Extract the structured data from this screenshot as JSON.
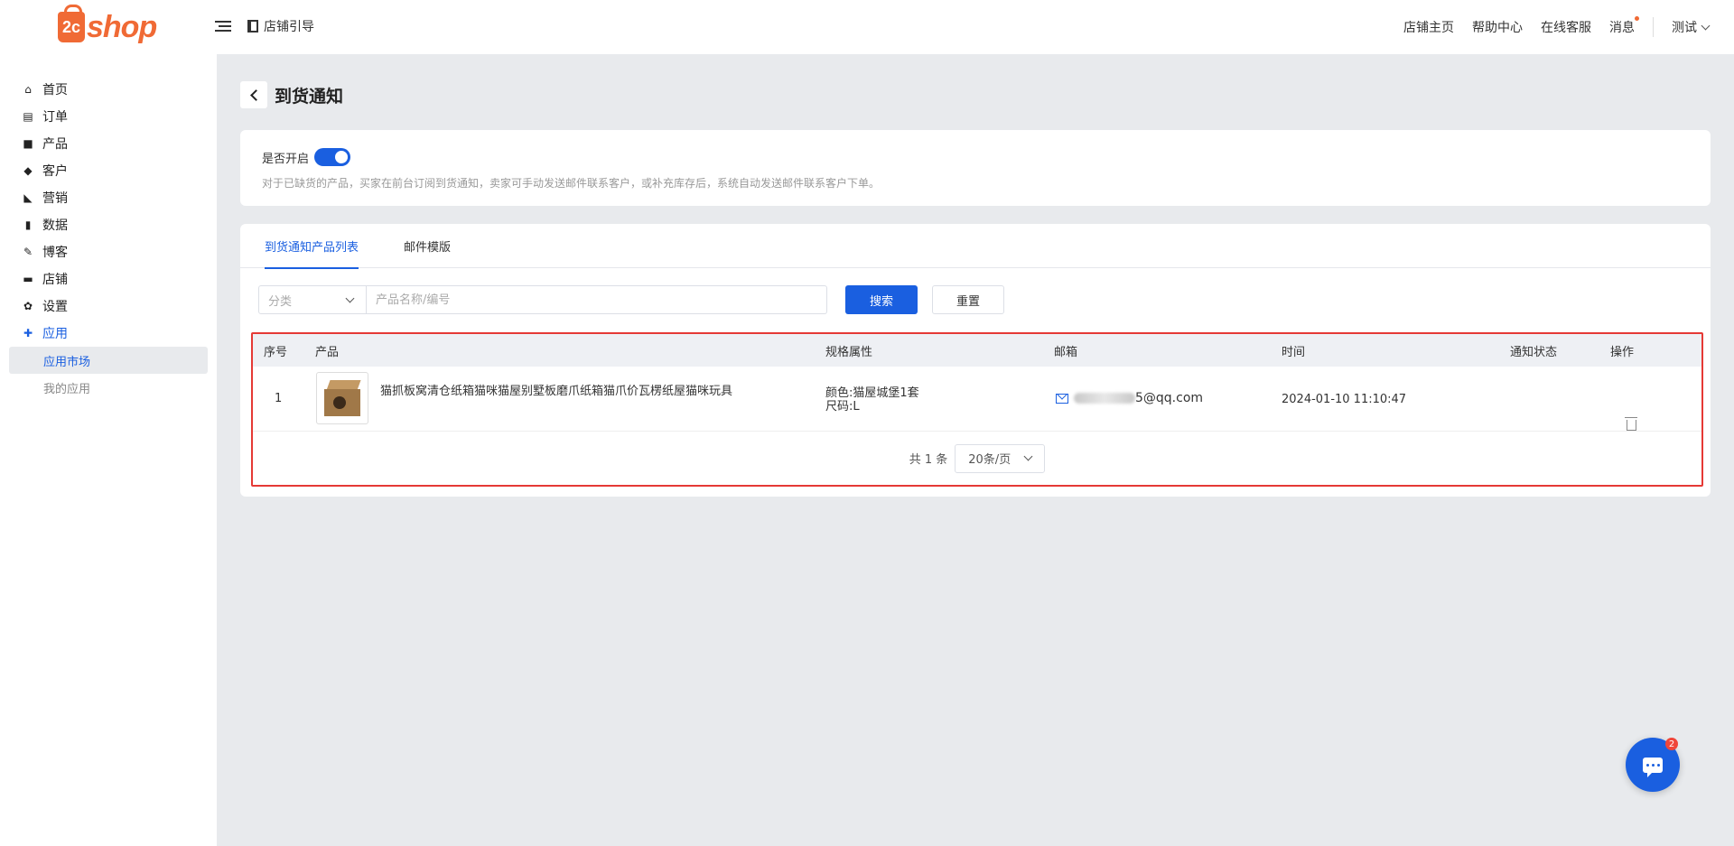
{
  "header": {
    "logo_text": "shop",
    "logo_mark": "2c",
    "guide_label": "店铺引导",
    "links": [
      "店铺主页",
      "帮助中心",
      "在线客服"
    ],
    "message_label": "消息",
    "user_label": "测试"
  },
  "sidebar": {
    "items": [
      {
        "label": "首页",
        "icon": "home-icon"
      },
      {
        "label": "订单",
        "icon": "clipboard-icon"
      },
      {
        "label": "产品",
        "icon": "bag-icon"
      },
      {
        "label": "客户",
        "icon": "diamond-icon"
      },
      {
        "label": "营销",
        "icon": "tag-icon"
      },
      {
        "label": "数据",
        "icon": "bar-chart-icon"
      },
      {
        "label": "博客",
        "icon": "edit-icon"
      },
      {
        "label": "店铺",
        "icon": "store-icon"
      },
      {
        "label": "设置",
        "icon": "gear-icon"
      },
      {
        "label": "应用",
        "icon": "puzzle-icon"
      }
    ],
    "sub_items": [
      "应用市场",
      "我的应用"
    ]
  },
  "page": {
    "title": "到货通知",
    "toggle_label": "是否开启",
    "toggle_on": true,
    "hint": "对于已缺货的产品，买家在前台订阅到货通知，卖家可手动发送邮件联系客户，或补充库存后，系统自动发送邮件联系客户下单。",
    "tabs": [
      "到货通知产品列表",
      "邮件模版"
    ],
    "filter": {
      "category_placeholder": "分类",
      "search_placeholder": "产品名称/编号",
      "search_button": "搜索",
      "reset_button": "重置"
    },
    "table": {
      "headers": [
        "序号",
        "产品",
        "规格属性",
        "邮箱",
        "时间",
        "通知状态",
        "操作"
      ],
      "rows": [
        {
          "index": "1",
          "product": "猫抓板窝清仓纸箱猫咪猫屋别墅板磨爪纸箱猫爪价瓦楞纸屋猫咪玩具",
          "spec_line1": "颜色:猫屋城堡1套",
          "spec_line2": "尺码:L",
          "email_suffix": "5@qq.com",
          "time": "2024-01-10 11:10:47",
          "status": ""
        }
      ]
    },
    "pager": {
      "total": "共 1 条",
      "page_size": "20条/页"
    }
  },
  "chat": {
    "badge": "2"
  },
  "colors": {
    "accent": "#1a5fe0",
    "brand": "#f06a35",
    "highlight": "#e53935"
  }
}
